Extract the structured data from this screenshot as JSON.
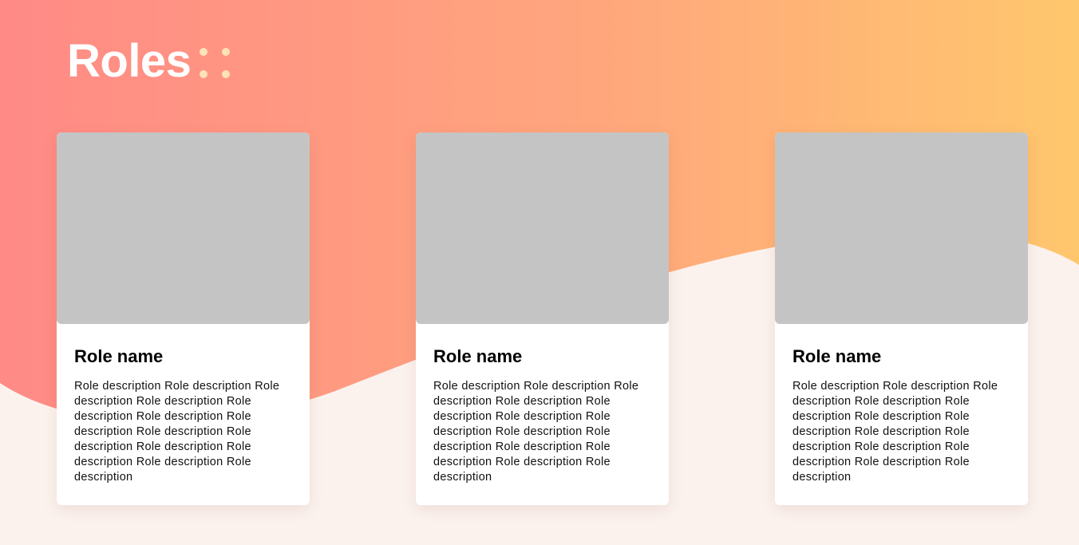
{
  "header": {
    "title": "Roles"
  },
  "colors": {
    "gradient_start": "#ff8a86",
    "gradient_end": "#ffc76d",
    "background": "#fbf2ee",
    "placeholder": "#c4c4c4",
    "dots": "#ffe3b8"
  },
  "cards": [
    {
      "name": "Role name",
      "description": "Role description Role description Role description Role description Role description Role description Role description Role description Role description Role description Role description Role description Role description"
    },
    {
      "name": "Role name",
      "description": "Role description Role description Role description Role description Role description Role description Role description Role description Role description Role description Role description Role description Role description"
    },
    {
      "name": "Role name",
      "description": "Role description Role description Role description Role description Role description Role description Role description Role description Role description Role description Role description Role description Role description"
    }
  ]
}
